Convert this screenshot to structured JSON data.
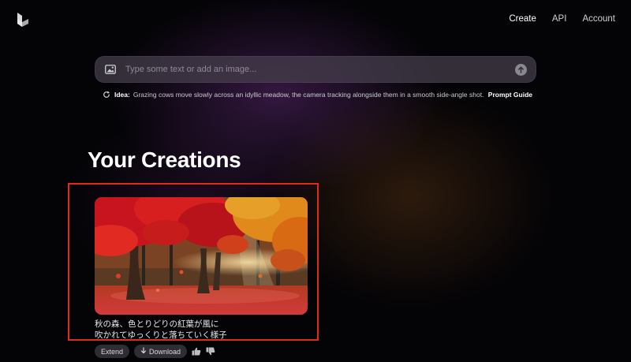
{
  "header": {
    "logo_icon": "cube-logo-icon",
    "nav": [
      {
        "label": "Create",
        "active": true
      },
      {
        "label": "API",
        "active": false
      },
      {
        "label": "Account",
        "active": false
      }
    ]
  },
  "prompt": {
    "image_icon": "image-icon",
    "placeholder": "Type some text or add an image...",
    "value": "",
    "submit_icon": "arrow-up-icon"
  },
  "idea": {
    "refresh_icon": "refresh-icon",
    "label": "Idea:",
    "text": "Grazing cows move slowly across an idyllic meadow, the camera tracking alongside them in a smooth side-angle shot.",
    "guide_label": "Prompt Guide"
  },
  "creations": {
    "title": "Your Creations",
    "items": [
      {
        "thumbnail": "autumn-forest-image",
        "caption_line1": "秋の森、色とりどりの紅葉が風に",
        "caption_line2": "吹かれてゆっくりと落ちていく様子",
        "extend_label": "Extend",
        "download_label": "Download",
        "download_icon": "download-arrow-icon",
        "like_icon": "thumbs-up-icon",
        "dislike_icon": "thumbs-down-icon"
      }
    ]
  },
  "colors": {
    "highlight_border": "#e02a1b",
    "background": "#040306",
    "prompt_bar": "#46404e"
  }
}
